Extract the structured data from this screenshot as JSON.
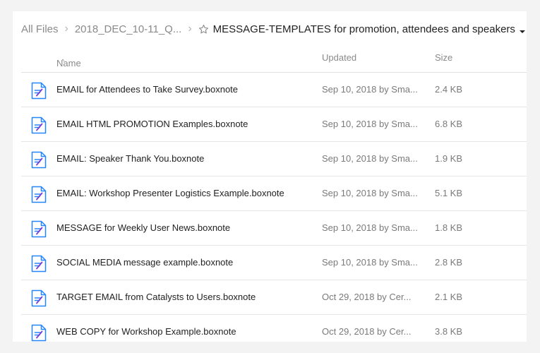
{
  "breadcrumb": {
    "root": "All Files",
    "parent": "2018_DEC_10-11_Q...",
    "current": "MESSAGE-TEMPLATES for promotion, attendees and speakers"
  },
  "columns": {
    "name": "Name",
    "updated": "Updated",
    "size": "Size"
  },
  "icons": {
    "file": "boxnote-file-icon",
    "favorite": "star-icon",
    "sort": "sort-ascending-icon",
    "dropdown": "caret-down-icon"
  },
  "colors": {
    "icon_blue": "#2486fc",
    "icon_purple": "#7a3dd6"
  },
  "files": [
    {
      "name": "EMAIL for Attendees to Take Survey.boxnote",
      "updated": "Sep 10, 2018 by Sma...",
      "size": "2.4 KB"
    },
    {
      "name": "EMAIL HTML PROMOTION Examples.boxnote",
      "updated": "Sep 10, 2018 by Sma...",
      "size": "6.8 KB"
    },
    {
      "name": "EMAIL: Speaker Thank You.boxnote",
      "updated": "Sep 10, 2018 by Sma...",
      "size": "1.9 KB"
    },
    {
      "name": "EMAIL: Workshop Presenter Logistics Example.boxnote",
      "updated": "Sep 10, 2018 by Sma...",
      "size": "5.1 KB"
    },
    {
      "name": "MESSAGE for Weekly User News.boxnote",
      "updated": "Sep 10, 2018 by Sma...",
      "size": "1.8 KB"
    },
    {
      "name": "SOCIAL MEDIA message example.boxnote",
      "updated": "Sep 10, 2018 by Sma...",
      "size": "2.8 KB"
    },
    {
      "name": "TARGET EMAIL from Catalysts to Users.boxnote",
      "updated": "Oct 29, 2018 by Cer...",
      "size": "2.1 KB"
    },
    {
      "name": "WEB COPY for Workshop Example.boxnote",
      "updated": "Oct 29, 2018 by Cer...",
      "size": "3.8 KB"
    }
  ]
}
